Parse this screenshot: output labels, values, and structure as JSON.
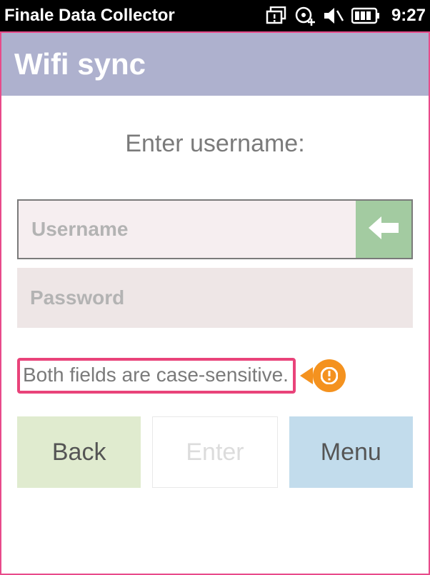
{
  "status": {
    "title": "Finale Data Collector",
    "time": "9:27"
  },
  "header": {
    "title": "Wifi sync"
  },
  "prompt": "Enter username:",
  "fields": {
    "username_placeholder": "Username",
    "username_value": "",
    "password_placeholder": "Password",
    "password_value": ""
  },
  "callout": {
    "text": "Both fields are case-sensitive."
  },
  "buttons": {
    "back": "Back",
    "enter": "Enter",
    "menu": "Menu"
  }
}
